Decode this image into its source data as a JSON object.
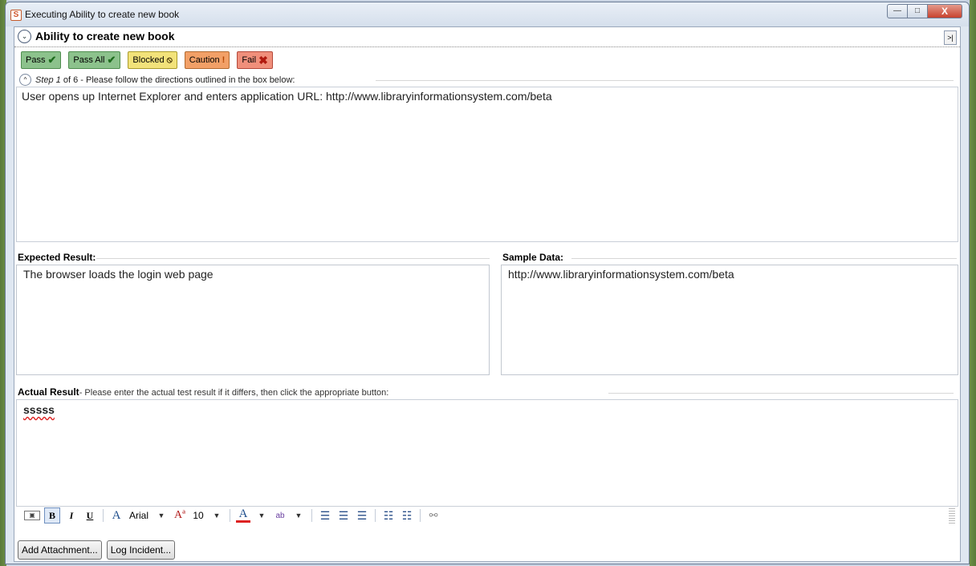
{
  "window": {
    "title": "Executing Ability to create new book",
    "icon_glyph": "S",
    "controls": {
      "minimize": "—",
      "maximize": "□",
      "close": "X"
    }
  },
  "header": {
    "title": "Ability to create new book",
    "collapse_glyph": "⌄",
    "expand_glyph": ">|"
  },
  "status_buttons": [
    {
      "label": "Pass",
      "symbol": "✔",
      "color": "#8cc28c"
    },
    {
      "label": "Pass All",
      "symbol": "✔",
      "color": "#8cc28c"
    },
    {
      "label": "Blocked",
      "symbol": "⦸",
      "color": "#f2e27a"
    },
    {
      "label": "Caution",
      "symbol": "!",
      "color": "#f2a067"
    },
    {
      "label": "Fail",
      "symbol": "✖",
      "color": "#f08f7b"
    }
  ],
  "step": {
    "prefix": "Step 1",
    "text": " of 6 - Please follow the directions outlined in the box below:",
    "collapse_glyph": "^"
  },
  "directions": "User opens up Internet Explorer and enters application URL: http://www.libraryinformationsystem.com/beta",
  "expected": {
    "label": "Expected Result:",
    "value": "The browser loads the login web page"
  },
  "sample": {
    "label": "Sample Data:",
    "value": "http://www.libraryinformationsystem.com/beta"
  },
  "actual": {
    "label": "Actual Result",
    "hint": "- Please enter the actual test result if it differs, then click the appropriate button:",
    "value": "sssss"
  },
  "toolbar": {
    "font_name": "Arial",
    "font_size": "10",
    "bold": "B",
    "italic": "I",
    "underline": "U",
    "font_icon": "A",
    "size_icon": "Aª",
    "color_icon": "A",
    "highlight_icon": "ab",
    "caret": "▼",
    "align_left": "☰",
    "align_center": "☰",
    "align_right": "☰",
    "bullets": "☷",
    "numbering": "☷",
    "link": "⚯",
    "picture": "▣"
  },
  "footer": {
    "add_attachment": "Add Attachment...",
    "log_incident": "Log Incident..."
  }
}
